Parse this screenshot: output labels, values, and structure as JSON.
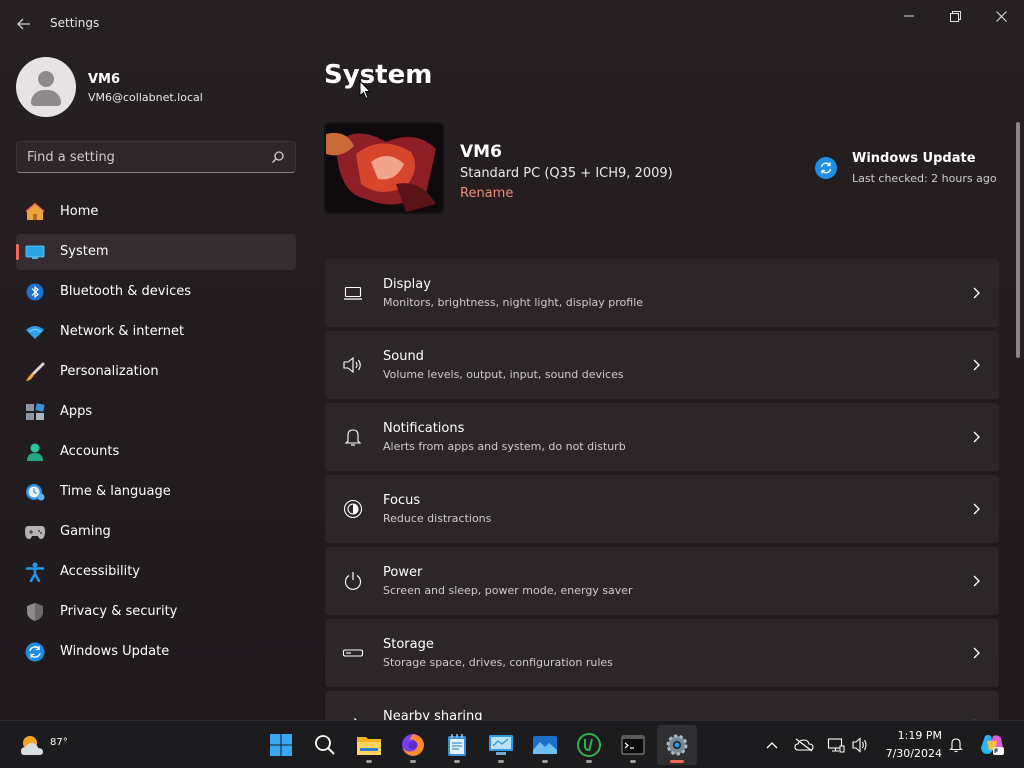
{
  "window": {
    "title": "Settings",
    "back_icon": "back-arrow-icon",
    "controls": [
      "minimize-icon",
      "restore-icon",
      "close-icon"
    ]
  },
  "profile": {
    "name": "VM6",
    "email": "VM6@collabnet.local"
  },
  "search": {
    "placeholder": "Find a setting"
  },
  "nav": {
    "items": [
      {
        "label": "Home",
        "icon": "home-icon"
      },
      {
        "label": "System",
        "icon": "system-icon",
        "active": true
      },
      {
        "label": "Bluetooth & devices",
        "icon": "bluetooth-icon"
      },
      {
        "label": "Network & internet",
        "icon": "wifi-icon"
      },
      {
        "label": "Personalization",
        "icon": "brush-icon"
      },
      {
        "label": "Apps",
        "icon": "apps-icon"
      },
      {
        "label": "Accounts",
        "icon": "accounts-icon"
      },
      {
        "label": "Time & language",
        "icon": "time-language-icon"
      },
      {
        "label": "Gaming",
        "icon": "gamepad-icon"
      },
      {
        "label": "Accessibility",
        "icon": "accessibility-icon"
      },
      {
        "label": "Privacy & security",
        "icon": "shield-icon"
      },
      {
        "label": "Windows Update",
        "icon": "windows-update-icon"
      }
    ]
  },
  "main": {
    "title": "System",
    "device": {
      "name": "VM6",
      "model": "Standard PC (Q35 + ICH9, 2009)",
      "rename_label": "Rename"
    },
    "windows_update": {
      "title": "Windows Update",
      "status": "Last checked: 2 hours ago"
    },
    "cards": [
      {
        "title": "Display",
        "subtitle": "Monitors, brightness, night light, display profile",
        "icon": "monitor-icon"
      },
      {
        "title": "Sound",
        "subtitle": "Volume levels, output, input, sound devices",
        "icon": "speaker-icon"
      },
      {
        "title": "Notifications",
        "subtitle": "Alerts from apps and system, do not disturb",
        "icon": "bell-icon"
      },
      {
        "title": "Focus",
        "subtitle": "Reduce distractions",
        "icon": "focus-icon"
      },
      {
        "title": "Power",
        "subtitle": "Screen and sleep, power mode, energy saver",
        "icon": "power-icon"
      },
      {
        "title": "Storage",
        "subtitle": "Storage space, drives, configuration rules",
        "icon": "storage-icon"
      },
      {
        "title": "Nearby sharing",
        "subtitle": "",
        "icon": "share-icon"
      }
    ]
  },
  "taskbar": {
    "weather_temp": "87°",
    "apps": [
      "start-icon",
      "search-icon",
      "file-explorer-icon",
      "firefox-icon",
      "notepad-icon",
      "control-panel-icon",
      "photos-icon",
      "upwork-icon",
      "terminal-icon",
      "settings-icon"
    ],
    "tray": [
      "chevron-up-icon",
      "onedrive-off-icon",
      "network-icon",
      "volume-icon"
    ],
    "time": "1:19 PM",
    "date": "7/30/2024",
    "accent": "#f06a5a"
  }
}
